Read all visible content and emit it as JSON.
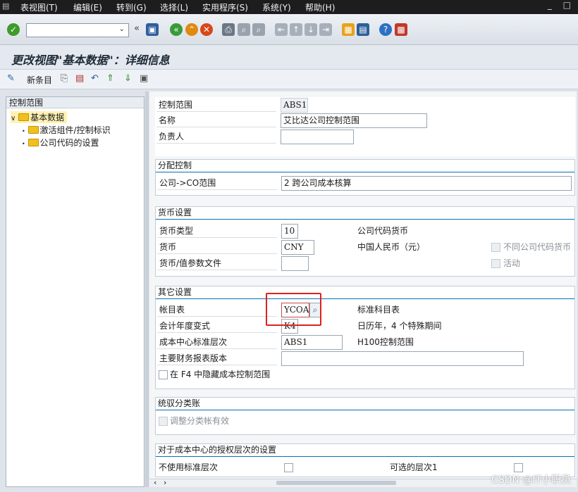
{
  "menubar": {
    "items": [
      "表视图(T)",
      "编辑(E)",
      "转到(G)",
      "选择(L)",
      "实用程序(S)",
      "系统(Y)",
      "帮助(H)"
    ],
    "window_controls": "_ □"
  },
  "toolbar": {
    "command_field_value": "",
    "icons": [
      "check-icon",
      "back-icon",
      "exit-icon",
      "cancel-icon",
      "save-icon",
      "print-icon",
      "find-icon",
      "find-next-icon",
      "first-page-icon",
      "prev-page-icon",
      "next-page-icon",
      "last-page-icon",
      "create-session-icon",
      "shortcut-icon",
      "help-icon",
      "customize-layout-icon"
    ]
  },
  "page_title": "更改视图\"基本数据\"：详细信息",
  "app_toolbar": {
    "new_entries_label": "新条目"
  },
  "tree": {
    "header": "控制范围",
    "root": "基本数据",
    "children": [
      "激活组件/控制标识",
      "公司代码的设置"
    ]
  },
  "detail": {
    "header_fields": {
      "controlling_area_label": "控制范围",
      "controlling_area_value": "ABS1",
      "name_label": "名称",
      "name_value": "艾比达公司控制范围",
      "responsible_label": "负责人",
      "responsible_value": ""
    },
    "assignment": {
      "title": "分配控制",
      "company_co_label": "公司->CO范围",
      "company_co_value": "2 跨公司成本核算"
    },
    "currency": {
      "title": "货币设置",
      "currency_type_label": "货币类型",
      "currency_type_value": "10",
      "currency_type_desc": "公司代码货币",
      "currency_label": "货币",
      "currency_value": "CNY",
      "currency_desc": "中国人民币（元）",
      "diff_cc_currency_label": "不同公司代码货币",
      "currency_value_profile_label": "货币/值参数文件",
      "currency_value_profile_value": "",
      "active_label": "活动"
    },
    "other": {
      "title": "其它设置",
      "chart_of_accounts_label": "帐目表",
      "chart_of_accounts_value": "YCOA",
      "chart_of_accounts_desc": "标准科目表",
      "fiscal_year_variant_label": "会计年度变式",
      "fiscal_year_variant_value": "K4",
      "fiscal_year_variant_desc": "日历年，4 个特殊期间",
      "std_hierarchy_label": "成本中心标准层次",
      "std_hierarchy_value": "ABS1",
      "std_hierarchy_desc": "H100控制范围",
      "fin_stmt_version_label": "主要财务报表版本",
      "fin_stmt_version_value": "",
      "hide_co_area_label": "在 F4 中隐藏成本控制范围"
    },
    "ledger": {
      "title": "统驭分类账",
      "reconciliation_active_label": "调整分类帐有效"
    },
    "auth": {
      "title": "对于成本中心的授权层次的设置",
      "no_std_hierarchy_label": "不使用标准层次",
      "alt_hierarchy_label": "可选的层次1"
    }
  },
  "watermark": "CSDN @IT小职员"
}
